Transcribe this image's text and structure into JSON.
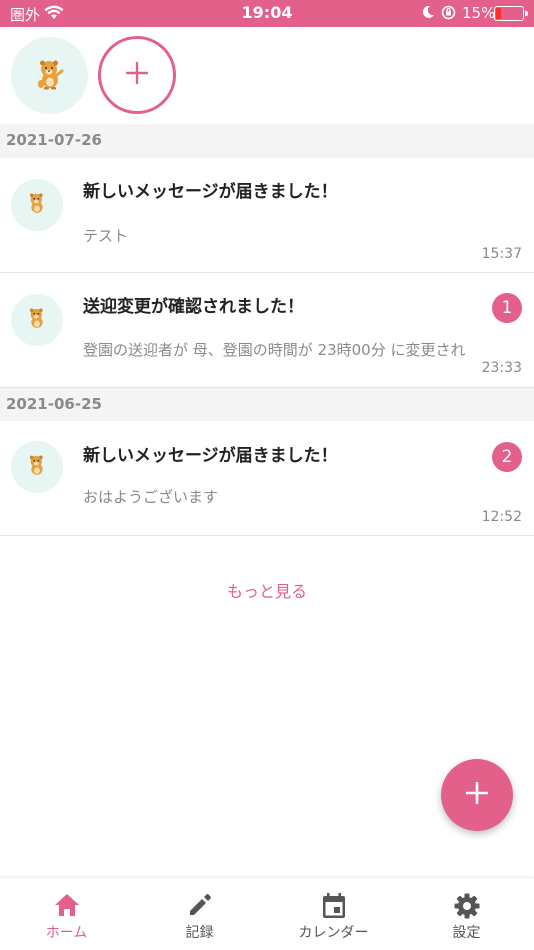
{
  "status_bar": {
    "carrier": "圏外",
    "time": "19:04",
    "battery": "15%"
  },
  "children": [
    {
      "avatar_icon": "bear-character-icon"
    }
  ],
  "sections": [
    {
      "date": "2021-07-26",
      "items": [
        {
          "title": "新しいメッセージが届きました！",
          "body": "テスト",
          "time": "15:37",
          "badge": ""
        },
        {
          "title": "送迎変更が確認されました！",
          "body": "登園の送迎者が 母、登園の時間が 23時00分 に変更され",
          "time": "23:33",
          "badge": "1"
        }
      ]
    },
    {
      "date": "2021-06-25",
      "items": [
        {
          "title": "新しいメッセージが届きました！",
          "body": "おはようございます",
          "time": "12:52",
          "badge": "2"
        }
      ]
    }
  ],
  "more_label": "もっと見る",
  "nav": [
    {
      "label": "ホーム",
      "icon": "home-icon",
      "active": true
    },
    {
      "label": "記録",
      "icon": "pencil-icon",
      "active": false
    },
    {
      "label": "カレンダー",
      "icon": "calendar-icon",
      "active": false
    },
    {
      "label": "設定",
      "icon": "gear-icon",
      "active": false
    }
  ],
  "colors": {
    "accent": "#e2608a",
    "avatar_bg": "#e7f6f3",
    "section_bg": "#f4f4f4"
  }
}
